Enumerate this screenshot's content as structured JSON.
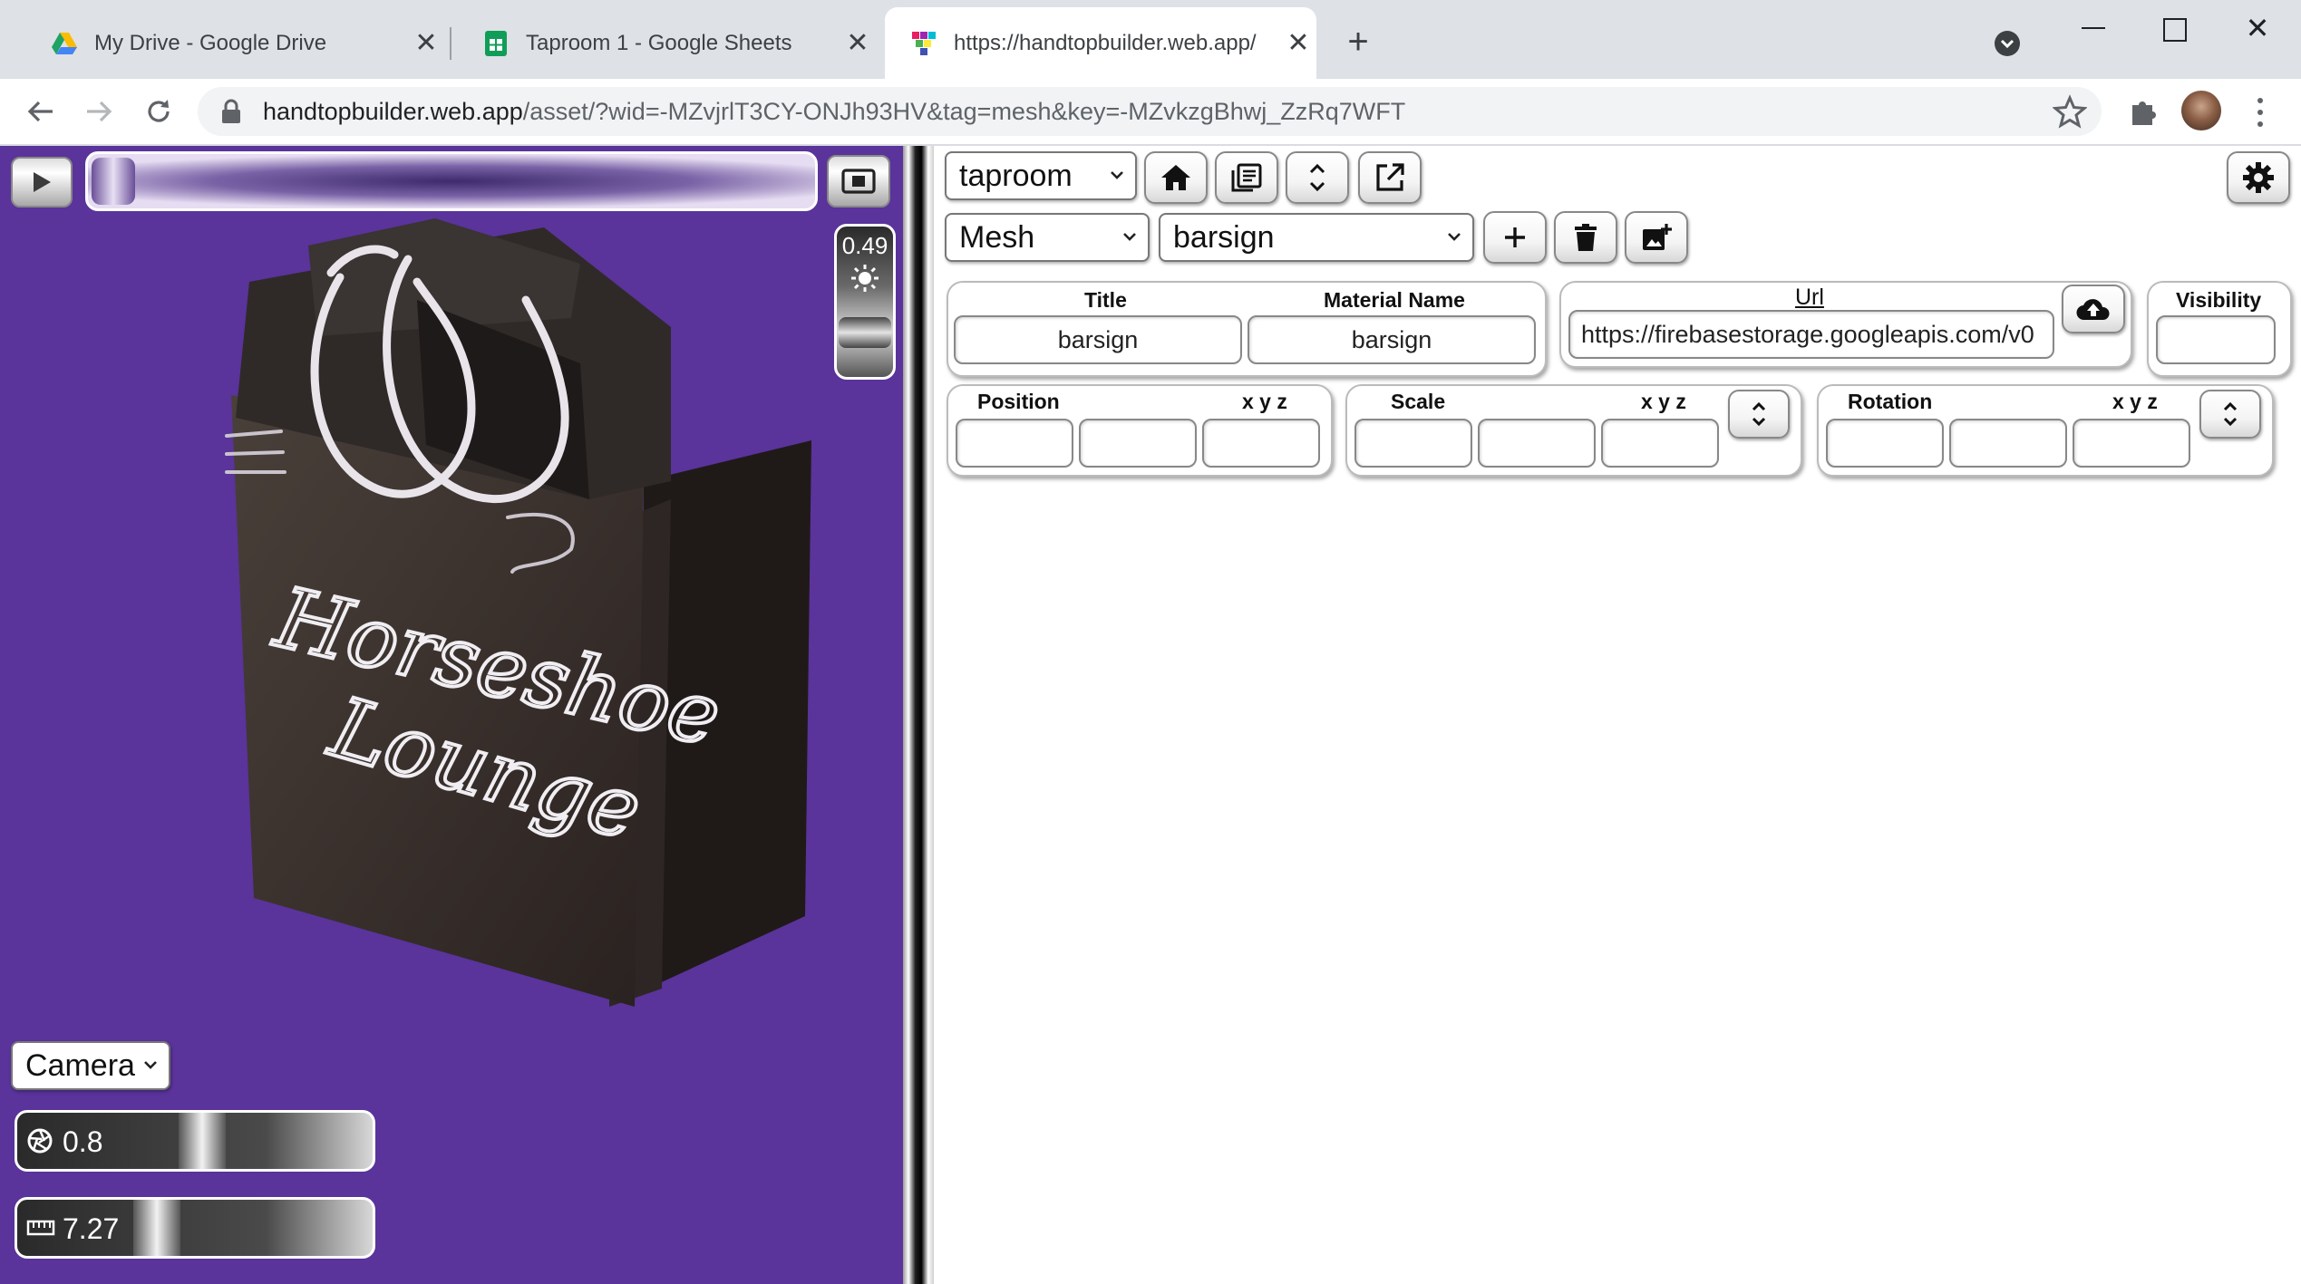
{
  "browser": {
    "tabs": [
      {
        "title": "My Drive - Google Drive",
        "icon": "google-drive-icon"
      },
      {
        "title": "Taproom 1 - Google Sheets",
        "icon": "google-sheets-icon"
      },
      {
        "title": "https://handtopbuilder.web.app/",
        "icon": "handtop-favicon",
        "active": true
      }
    ],
    "url_host": "handtopbuilder.web.app",
    "url_path": "/asset/?wid=-MZvjrlT3CY-ONJh93HV&tag=mesh&key=-MZvkzgBhwj_ZzRq7WFT"
  },
  "viewport": {
    "background": "#5a339b",
    "brightness_value": "0.49",
    "camera_select": "Camera",
    "slider1_value": "0.8",
    "slider2_value": "7.27",
    "sign_text_line1": "Horseshoe",
    "sign_text_line2": "Lounge"
  },
  "panel": {
    "workspace_select": "taproom",
    "type_select": "Mesh",
    "asset_select": "barsign",
    "title_label": "Title",
    "title_value": "barsign",
    "material_label": "Material Name",
    "material_value": "barsign",
    "url_label": "Url",
    "url_value": "https://firebasestorage.googleapis.com/v0",
    "visibility_label": "Visibility",
    "position_label": "Position",
    "scale_label": "Scale",
    "rotation_label": "Rotation",
    "xyz_label": "x y z"
  }
}
